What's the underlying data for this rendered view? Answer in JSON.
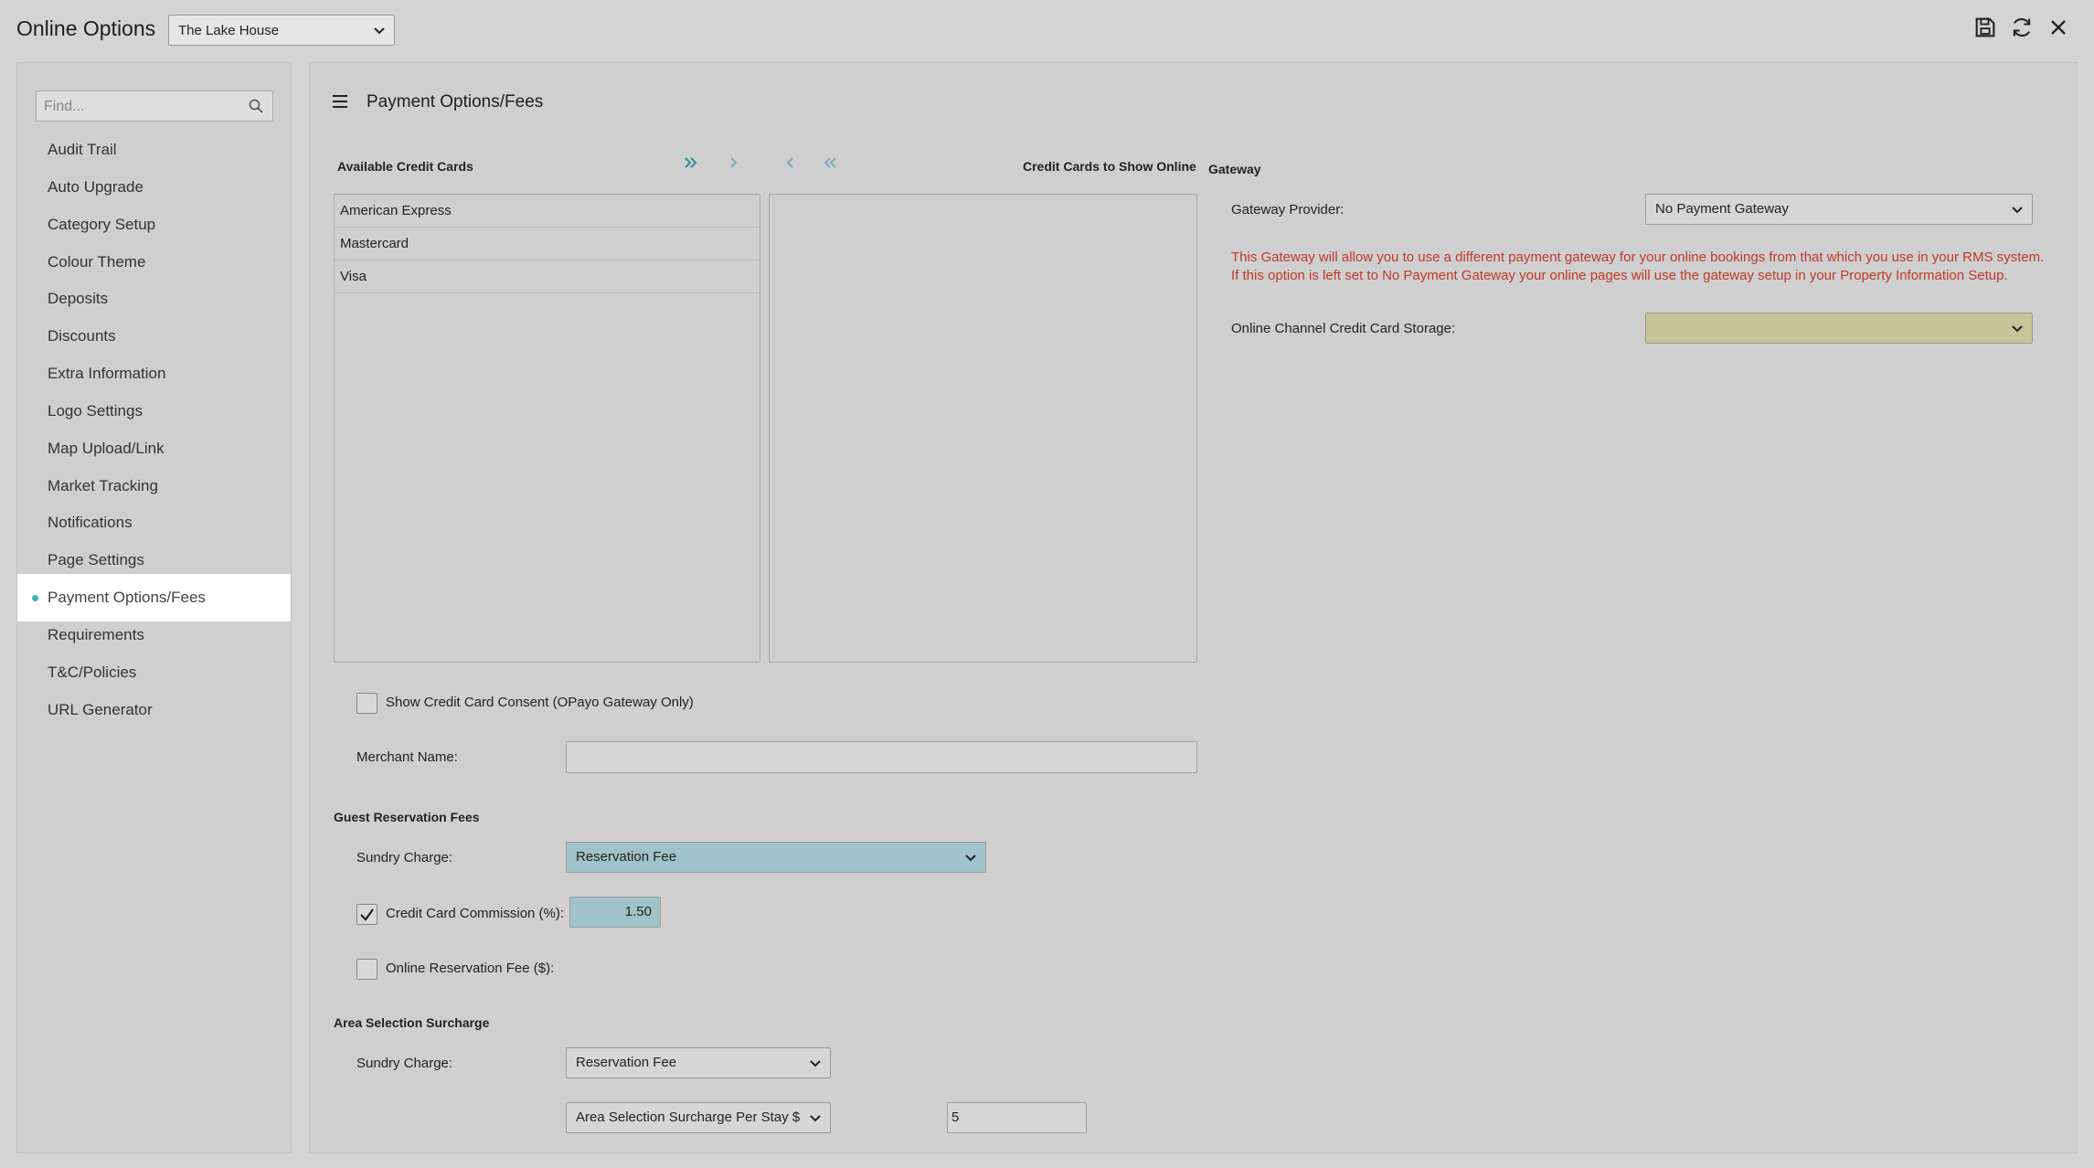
{
  "window": {
    "title": "Online Options",
    "property": "The Lake House"
  },
  "sidebar": {
    "search_placeholder": "Find...",
    "items": [
      {
        "label": "Audit Trail"
      },
      {
        "label": "Auto Upgrade"
      },
      {
        "label": "Category Setup"
      },
      {
        "label": "Colour Theme"
      },
      {
        "label": "Deposits"
      },
      {
        "label": "Discounts"
      },
      {
        "label": "Extra Information"
      },
      {
        "label": "Logo Settings"
      },
      {
        "label": "Map Upload/Link"
      },
      {
        "label": "Market Tracking"
      },
      {
        "label": "Notifications"
      },
      {
        "label": "Page Settings"
      },
      {
        "label": "Payment Options/Fees",
        "active": true
      },
      {
        "label": "Requirements"
      },
      {
        "label": "T&C/Policies"
      },
      {
        "label": "URL Generator"
      }
    ]
  },
  "main": {
    "title": "Payment Options/Fees",
    "available_cards_label": "Available Credit Cards",
    "show_online_label": "Credit Cards to Show Online",
    "available_cards": [
      "American Express",
      "Mastercard",
      "Visa"
    ],
    "show_online_cards": [],
    "consent_label": "Show Credit Card Consent (OPayo Gateway Only)",
    "consent_checked": false,
    "merchant_label": "Merchant Name:",
    "merchant_value": "",
    "guest_fees_heading": "Guest Reservation Fees",
    "sundry_label": "Sundry Charge:",
    "sundry_value": "Reservation Fee",
    "commission_label": "Credit Card Commission (%):",
    "commission_checked": true,
    "commission_value": "1.50",
    "online_fee_label": "Online Reservation Fee ($):",
    "online_fee_checked": false,
    "area_heading": "Area Selection Surcharge",
    "area_sundry_label": "Sundry Charge:",
    "area_sundry_value": "Reservation Fee",
    "area_type_value": "Area Selection Surcharge Per Stay $",
    "area_amount_value": "5"
  },
  "gateway": {
    "heading": "Gateway",
    "provider_label": "Gateway Provider:",
    "provider_value": "No Payment Gateway",
    "note": "This Gateway will allow you to use a different payment gateway for your online bookings from that which you use in your RMS system. If this option is left set to No Payment Gateway your online pages will use the gateway setup in your Property Information Setup.",
    "storage_label": "Online Channel Credit Card Storage:",
    "storage_value": ""
  },
  "colors": {
    "accent": "#3fb2c0",
    "highlight_field": "#9fc3c8",
    "warning_field": "#c8c49a",
    "note_text": "#c0392b"
  }
}
